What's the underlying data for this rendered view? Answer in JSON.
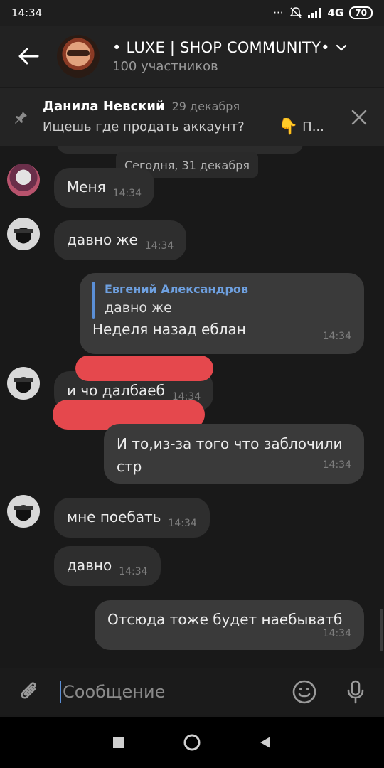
{
  "status_bar": {
    "time": "14:34",
    "network": "4G",
    "battery": "70"
  },
  "header": {
    "title": "• LUXE | SHOP COMMUNITY•",
    "subtitle": "100 участников"
  },
  "pinned": {
    "author": "Данила Невский",
    "date": "29 декабря",
    "text": "Ищешь где продать аккаунт?",
    "emoji": "👇",
    "ellipsis": "П..."
  },
  "feed": {
    "date_separator": "Сегодня, 31 декабря",
    "messages": [
      {
        "text": "Меня",
        "time": "14:34"
      },
      {
        "text": "давно же",
        "time": "14:34"
      },
      {
        "reply_author": "Евгений Александров",
        "reply_text": "давно же",
        "text": "Неделя назад еблан",
        "time": "14:34"
      },
      {
        "text": "и чо далбаеб",
        "time": "14:34"
      },
      {
        "text": "И то,из-за того что заблочили стр",
        "time": "14:34"
      },
      {
        "text": "мне поебать",
        "time": "14:34"
      },
      {
        "text": "давно",
        "time": "14:34"
      },
      {
        "text": "Отсюда тоже будет наебыватб",
        "time": "14:34"
      }
    ]
  },
  "composer": {
    "placeholder": "Сообщение"
  },
  "colors": {
    "accent": "#5b8fd6",
    "scribble": "#e5484d",
    "background": "#191919"
  },
  "icons": [
    "back-arrow-icon",
    "chevron-down-icon",
    "pin-icon",
    "close-icon",
    "attach-icon",
    "emoji-icon",
    "microphone-icon",
    "recent-apps-icon",
    "home-icon",
    "back-nav-icon"
  ]
}
